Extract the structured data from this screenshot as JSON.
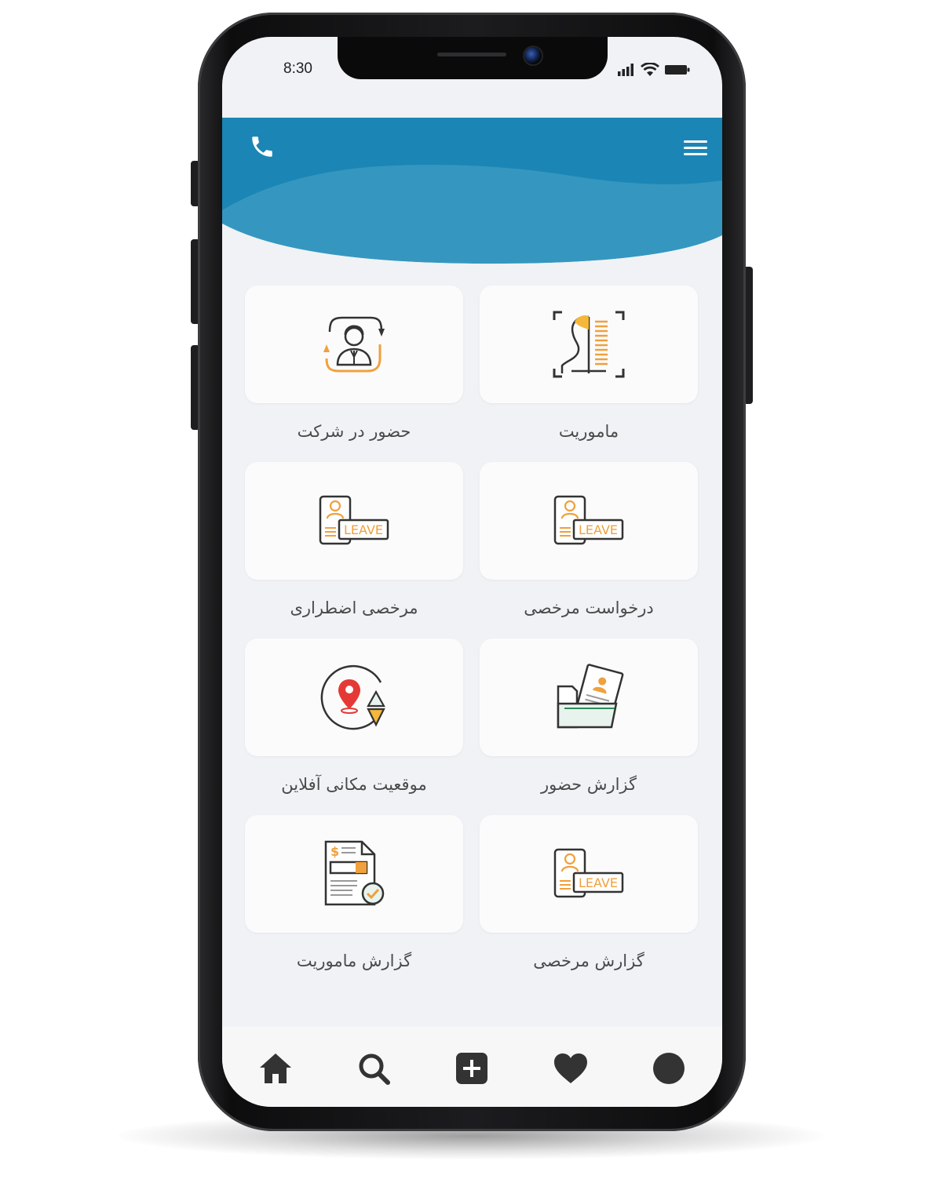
{
  "status_bar": {
    "time": "8:30",
    "signal_icon": "signal-icon",
    "wifi_icon": "wifi-icon",
    "battery_icon": "battery-icon"
  },
  "header": {
    "left_icon": "phone-icon",
    "right_icon": "menu-icon",
    "color": "#1b86b5"
  },
  "tiles": [
    {
      "label": "ماموریت",
      "icon": "face-scan-icon"
    },
    {
      "label": "حضور در شرکت",
      "icon": "attendance-user-icon"
    },
    {
      "label": "درخواست مرخصی",
      "icon": "leave-card-icon"
    },
    {
      "label": "مرخصی اضطراری",
      "icon": "leave-card-icon"
    },
    {
      "label": "گزارش حضور",
      "icon": "folder-profile-icon"
    },
    {
      "label": "موقعیت مکانی آفلاین",
      "icon": "location-sync-icon"
    },
    {
      "label": "گزارش مرخصی",
      "icon": "leave-card-icon"
    },
    {
      "label": "گزارش ماموریت",
      "icon": "invoice-check-icon"
    }
  ],
  "leave_badge_text": "LEAVE",
  "bottom_nav": [
    "home-icon",
    "search-icon",
    "add-icon",
    "heart-icon",
    "profile-icon"
  ],
  "colors": {
    "accent_orange": "#f0a03c",
    "header_blue": "#1b86b5",
    "icon_dark": "#333333"
  }
}
